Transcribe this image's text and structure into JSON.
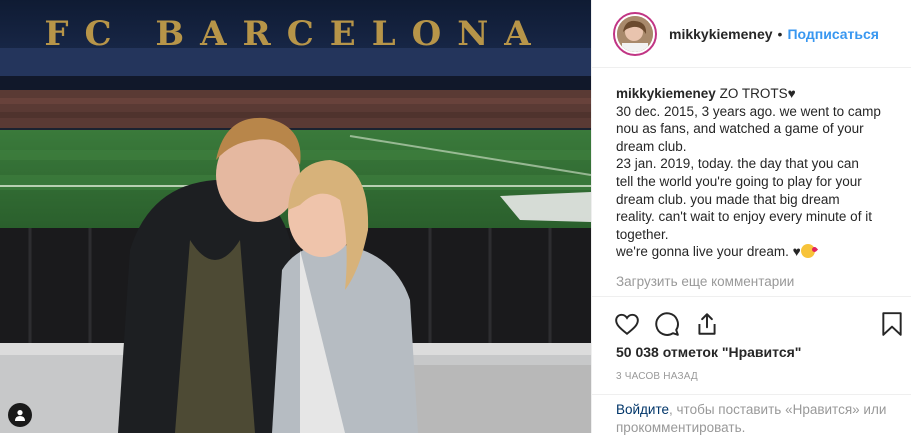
{
  "post": {
    "username": "mikkykiemeney",
    "follow_label": "Подписаться",
    "caption": {
      "lines": [
        "ZO TROTS♥",
        "30 dec. 2015, 3 years ago. we went to camp",
        "nou as fans, and watched a game of your",
        "dream club.",
        "23 jan. 2019, today. the day that you can",
        "tell the world you're going to play for your",
        "dream club. you made that big dream",
        "reality. can't wait to enjoy every minute of it",
        "together.",
        "we're gonna live your dream. ♥"
      ]
    },
    "load_comments_label": "Загрузить еще комментарии",
    "likes_text": "50 038 отметок \"Нравится\"",
    "time_ago": "3 часов назад",
    "login_prompt": {
      "link": "Войдите",
      "text": ", чтобы поставить «Нравится» или прокомментировать."
    }
  },
  "photo": {
    "stadium_banner": "FC BARCELONA"
  },
  "icons": {
    "like": "heart-icon",
    "comment": "comment-icon",
    "share": "share-icon",
    "save": "bookmark-icon",
    "tagged": "user-tag-icon"
  },
  "colors": {
    "follow": "#3897f0",
    "link": "#003569",
    "muted": "#999999",
    "text": "#262626",
    "story_ring": "#c13584"
  }
}
